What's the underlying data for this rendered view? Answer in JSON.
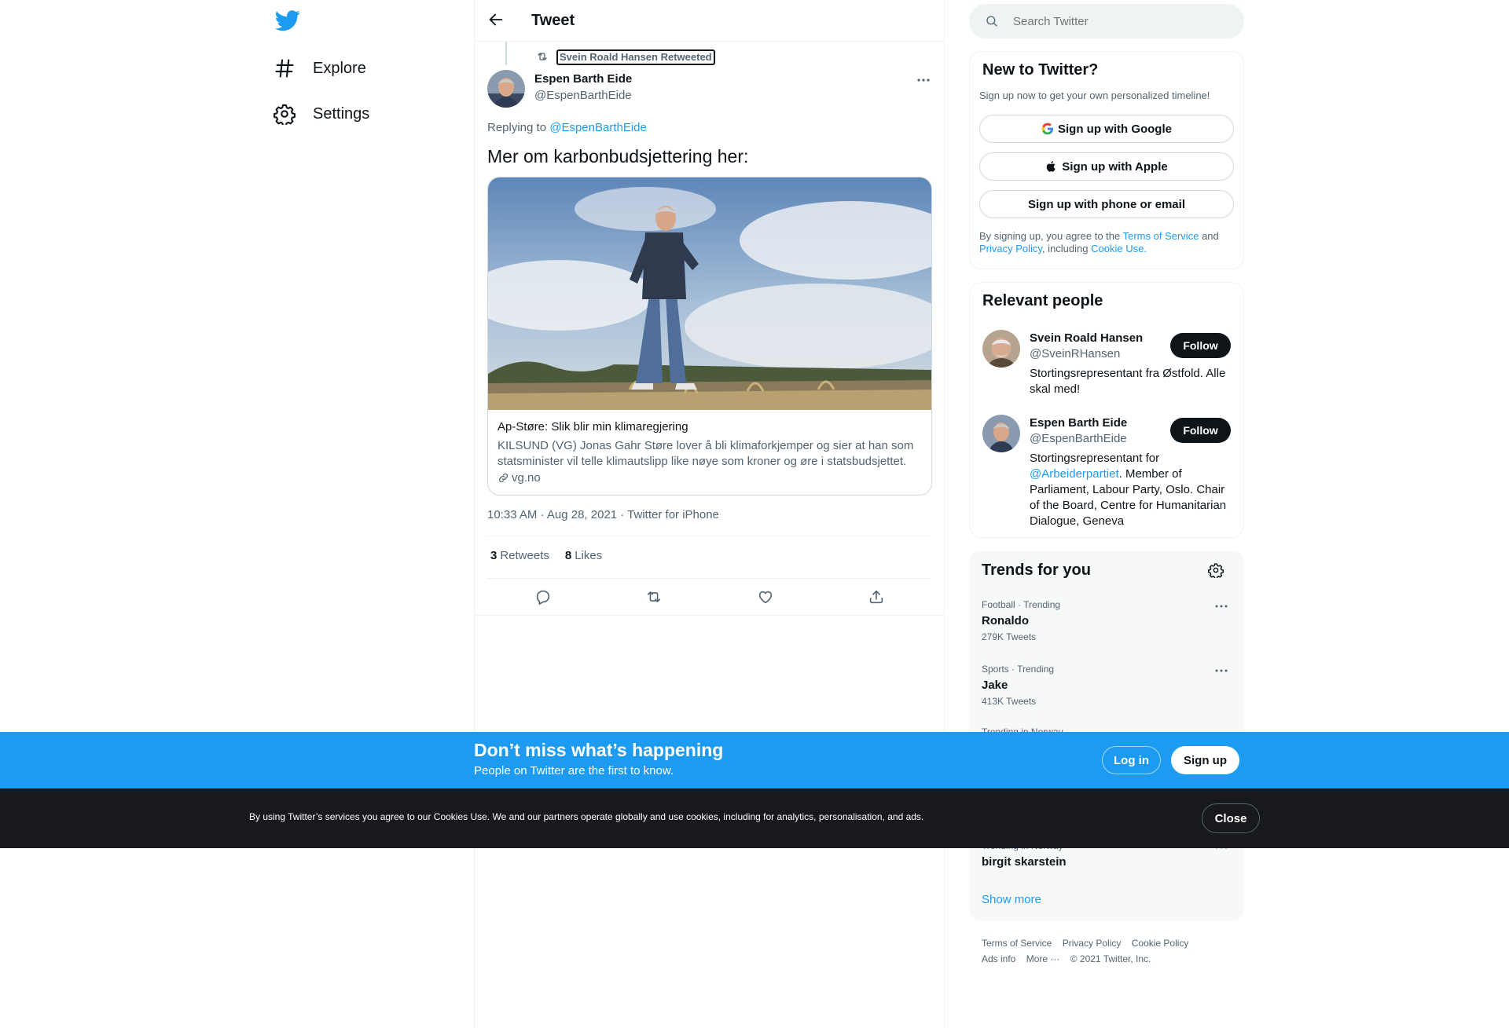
{
  "nav": {
    "items": [
      {
        "label": "Explore",
        "icon": "hashtag-icon"
      },
      {
        "label": "Settings",
        "icon": "gear-icon"
      }
    ]
  },
  "header": {
    "title": "Tweet"
  },
  "tweet": {
    "retweet_context": "Svein Roald Hansen Retweeted",
    "author_name": "Espen Barth Eide",
    "author_handle": "@EspenBarthEide",
    "replying_prefix": "Replying to",
    "replying_to": "@EspenBarthEide",
    "text": "Mer om karbonbudsjettering her:",
    "card": {
      "title": "Ap-Støre: Slik blir min klimaregjering",
      "description": "KILSUND (VG) Jonas Gahr Støre lover å bli klimaforkjemper og sier at han som statsminister vil telle klimautslipp like nøye som kroner og øre i statsbudsjettet.",
      "domain": "vg.no"
    },
    "timestamp": "10:33 AM · Aug 28, 2021 · Twitter for iPhone",
    "retweets_count": "3",
    "retweets_label": "Retweets",
    "likes_count": "8",
    "likes_label": "Likes"
  },
  "search": {
    "placeholder": "Search Twitter"
  },
  "new_to_twitter": {
    "title": "New to Twitter?",
    "subtitle": "Sign up now to get your own personalized timeline!",
    "google_btn": "Sign up with Google",
    "apple_btn": "Sign up with Apple",
    "phone_btn": "Sign up with phone or email",
    "legal_1": "By signing up, you agree to the",
    "terms": "Terms of Service",
    "legal_2": "and",
    "privacy": "Privacy Policy",
    "legal_3": ", including",
    "cookie": "Cookie Use",
    "legal_4": "."
  },
  "relevant_people": {
    "title": "Relevant people",
    "people": [
      {
        "name": "Svein Roald Hansen",
        "handle": "@SveinRHansen",
        "bio": "Stortingsrepresentant fra Østfold. Alle skal med!",
        "follow_label": "Follow"
      },
      {
        "name": "Espen Barth Eide",
        "handle": "@EspenBarthEide",
        "bio_prefix": "Stortingsrepresentant for",
        "bio_mention": "@Arbeiderpartiet",
        "bio_suffix": ". Member of Parliament, Labour Party, Oslo. Chair of the Board, Centre for Humanitarian Dialogue, Geneva",
        "follow_label": "Follow"
      }
    ]
  },
  "trends": {
    "title": "Trends for you",
    "items": [
      {
        "meta": "Football · Trending",
        "name": "Ronaldo",
        "count": "279K Tweets"
      },
      {
        "meta": "Sports · Trending",
        "name": "Jake",
        "count": "413K Tweets"
      }
    ],
    "partial_meta": "Trending in Norway",
    "obscured_meta": "Trending in Norway",
    "obscured_name": "birgit skarstein",
    "show_more": "Show more"
  },
  "footer": {
    "links": [
      "Terms of Service",
      "Privacy Policy",
      "Cookie Policy",
      "Ads info",
      "More ···",
      "© 2021 Twitter, Inc."
    ]
  },
  "cta": {
    "title": "Don’t miss what’s happening",
    "subtitle": "People on Twitter are the first to know.",
    "login": "Log in",
    "signup": "Sign up"
  },
  "cookie_banner": {
    "text": "By using Twitter’s services you agree to our Cookies Use. We and our partners operate globally and use cookies, including for analytics, personalisation, and ads.",
    "close": "Close"
  },
  "colors": {
    "brand": "#1d9bf0",
    "text": "#0f1419",
    "muted": "#536471",
    "cookie_bg": "#17191c"
  }
}
